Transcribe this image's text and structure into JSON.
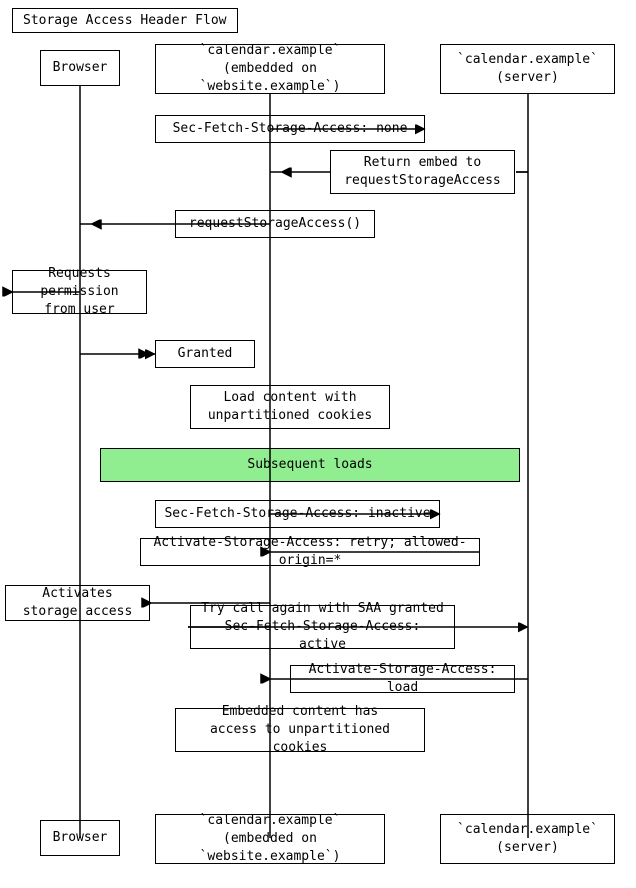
{
  "title": "Storage Access Header Flow",
  "nodes": {
    "title": "Storage Access Header Flow",
    "browser_top": "Browser",
    "calendar_embedded_top": "`calendar.example`\n(embedded on `website.example`)",
    "calendar_server_top": "`calendar.example`\n(server)",
    "sec_fetch_none": "Sec-Fetch-Storage-Access: none",
    "return_embed": "Return embed to\nrequestStorageAccess",
    "request_storage": "requestStorageAccess()",
    "requests_permission": "Requests permission\nfrom user",
    "granted": "Granted",
    "load_content": "Load content with\nunpartitioned cookies",
    "subsequent_loads": "Subsequent loads",
    "sec_fetch_inactive": "Sec-Fetch-Storage-Access: inactive",
    "activate_retry": "Activate-Storage-Access: retry; allowed-origin=*",
    "activates_storage": "Activates storage access",
    "try_call_again": "Try call again with SAA granted\nSec-Fetch-Storage-Access: active",
    "activate_load": "Activate-Storage-Access: load",
    "embedded_content": "Embedded content has\naccess to unpartitioned cookies",
    "browser_bottom": "Browser",
    "calendar_embedded_bottom": "`calendar.example`\n(embedded on `website.example`)",
    "calendar_server_bottom": "`calendar.example`\n(server)"
  }
}
